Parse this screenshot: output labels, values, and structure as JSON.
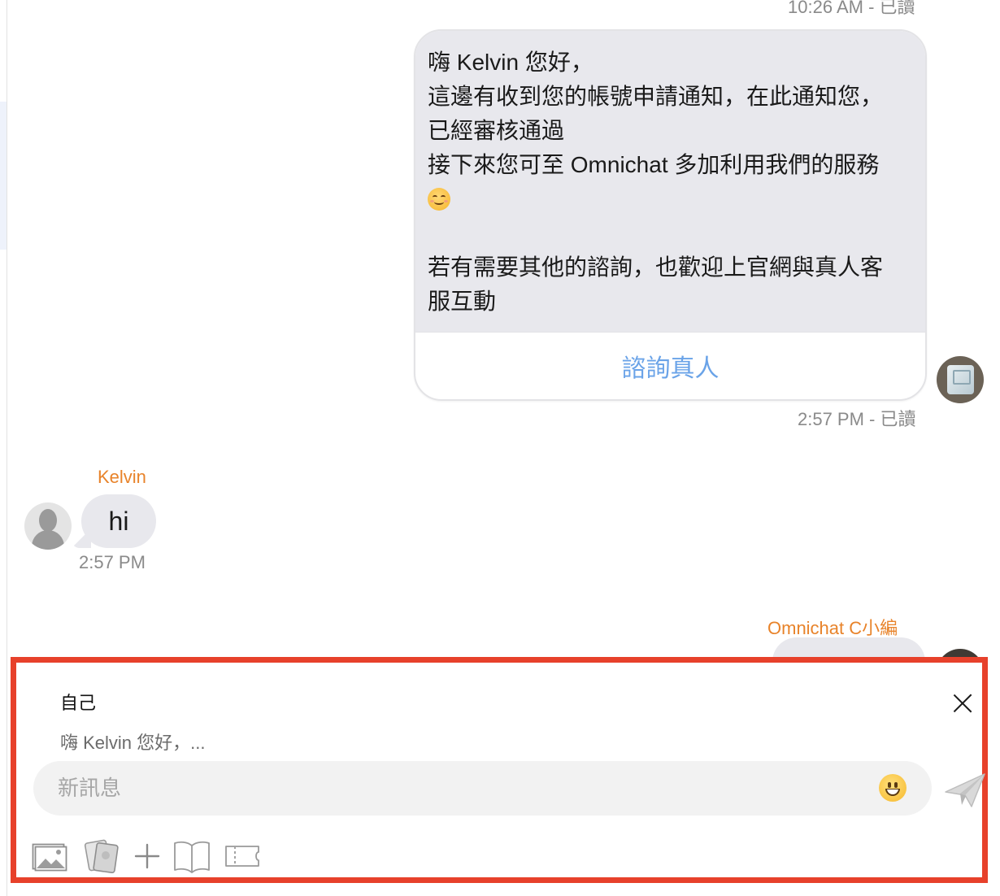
{
  "thread": {
    "top_meta": "10:26 AM - 已讀",
    "card": {
      "lines": [
        "嗨 Kelvin 您好，",
        "這邊有收到您的帳號申請通知，在此通知您，",
        "已經審核通過",
        "接下來您可至 Omnichat 多加利用我們的服務",
        "",
        "若有需要其他的諮詢，也歡迎上官網與真人客",
        "服互動"
      ],
      "emoji": "smiling-face",
      "button_label": "諮詢真人"
    },
    "card_meta": "2:57 PM - 已讀",
    "incoming": {
      "sender": "Kelvin",
      "text": "hi",
      "time": "2:57 PM"
    },
    "next_sender": "Omnichat C小編"
  },
  "composer": {
    "reply_to_name": "自己",
    "reply_to_preview": "嗨 Kelvin 您好，...",
    "input_placeholder": "新訊息",
    "input_value": "",
    "toolbar_icons": [
      "image-icon",
      "sticker-icon",
      "plus-icon",
      "book-icon",
      "ticket-icon"
    ]
  },
  "colors": {
    "highlight_frame": "#e7412b",
    "sender_name": "#e8832a",
    "card_button": "#6aa3e8",
    "bubble": "#e8e8ed"
  }
}
